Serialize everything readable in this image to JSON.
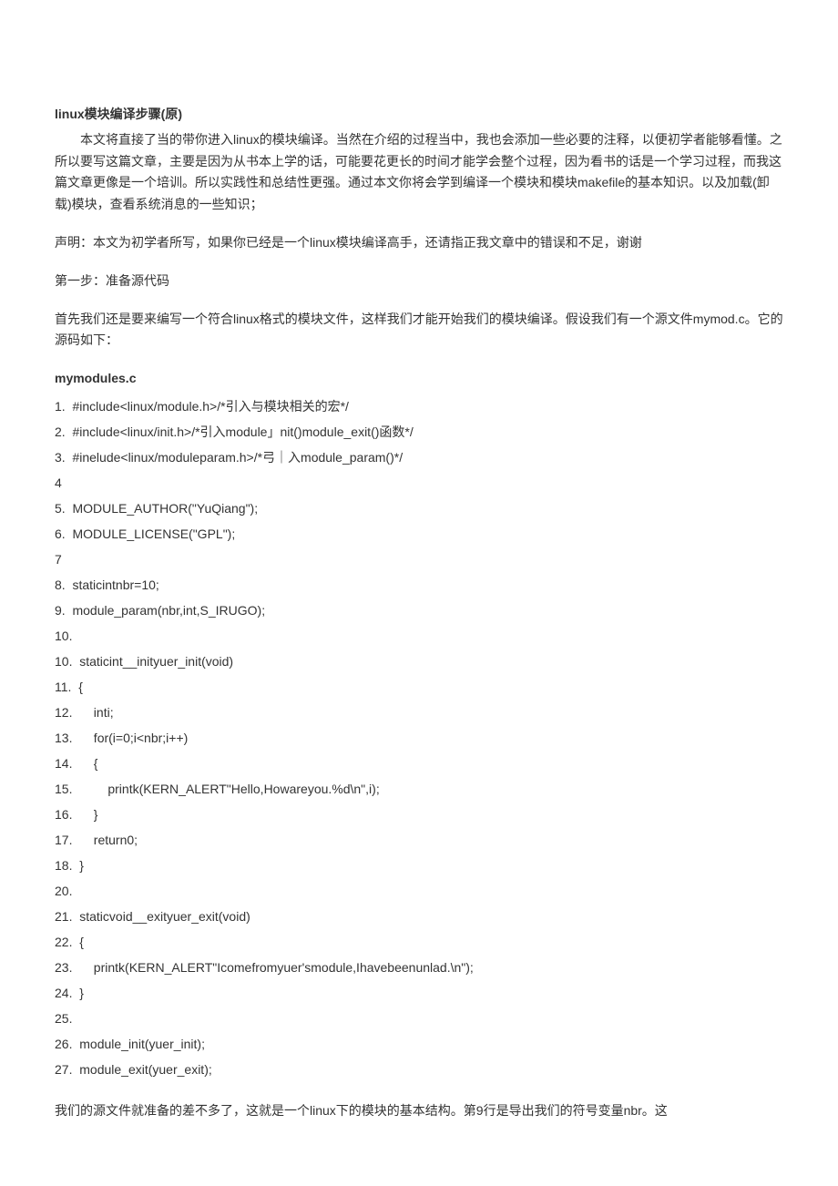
{
  "title": "linux模块编译步骤(原)",
  "intro": "本文将直接了当的带你进入linux的模块编译。当然在介绍的过程当中，我也会添加一些必要的注释，以便初学者能够看懂。之所以要写这篇文章，主要是因为从书本上学的话，可能要花更长的时间才能学会整个过程，因为看书的话是一个学习过程，而我这篇文章更像是一个培训。所以实践性和总结性更强。通过本文你将会学到编译一个模块和模块makefile的基本知识。以及加载(卸载)模块，查看系统消息的一些知识；",
  "disclaimer": "声明：本文为初学者所写，如果你已经是一个linux模块编译高手，还请指正我文章中的错误和不足，谢谢",
  "step1_heading": "第一步：准备源代码",
  "step1_para": "首先我们还是要来编写一个符合linux格式的模块文件，这样我们才能开始我们的模块编译。假设我们有一个源文件mymod.c。它的源码如下：",
  "code_filename": "mymodules.c",
  "code_lines": [
    "1.  #include<linux/module.h>/*引入与模块相关的宏*/",
    "2.  #include<linux/init.h>/*引入module」nit()module_exit()函数*/",
    "3.  #inelude<linux/moduleparam.h>/*弓｜入module_param()*/",
    "4",
    "5.  MODULE_AUTHOR(\"YuQiang\");",
    "6.  MODULE_LICENSE(\"GPL\");",
    "7",
    "8.  staticintnbr=10;",
    "9.  module_param(nbr,int,S_IRUGO);",
    "10.",
    "10.  staticint__inityuer_init(void)",
    "11.  {",
    "12.      inti;",
    "13.      for(i=0;i<nbr;i++)",
    "14.      {",
    "15.          printk(KERN_ALERT\"Hello,Howareyou.%d\\n\",i);",
    "16.      }",
    "17.      return0;",
    "18.  }",
    "20.",
    "21.  staticvoid__exityuer_exit(void)",
    "22.  {",
    "23.      printk(KERN_ALERT\"Icomefromyuer'smodule,Ihavebeenunlad.\\n\");",
    "24.  }",
    "25.",
    "26.  module_init(yuer_init);",
    "27.  module_exit(yuer_exit);"
  ],
  "closing_para": "我们的源文件就准备的差不多了，这就是一个linux下的模块的基本结构。第9行是导出我们的符号变量nbr。这"
}
